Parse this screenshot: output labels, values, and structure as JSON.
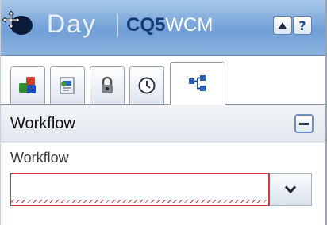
{
  "header": {
    "logo_day": "Day",
    "logo_cq": "CQ5",
    "logo_wcm": "WCM",
    "help_label": "?"
  },
  "tabs": [
    {
      "icon": "components-icon"
    },
    {
      "icon": "page-icon"
    },
    {
      "icon": "lock-icon"
    },
    {
      "icon": "versioning-clock-icon"
    },
    {
      "icon": "workflow-icon",
      "active": true
    }
  ],
  "panel": {
    "title": "Workflow",
    "field_label": "Workflow",
    "field_value": ""
  },
  "colors": {
    "header_blue": "#6f9fd6",
    "invalid_border": "#c64040"
  }
}
